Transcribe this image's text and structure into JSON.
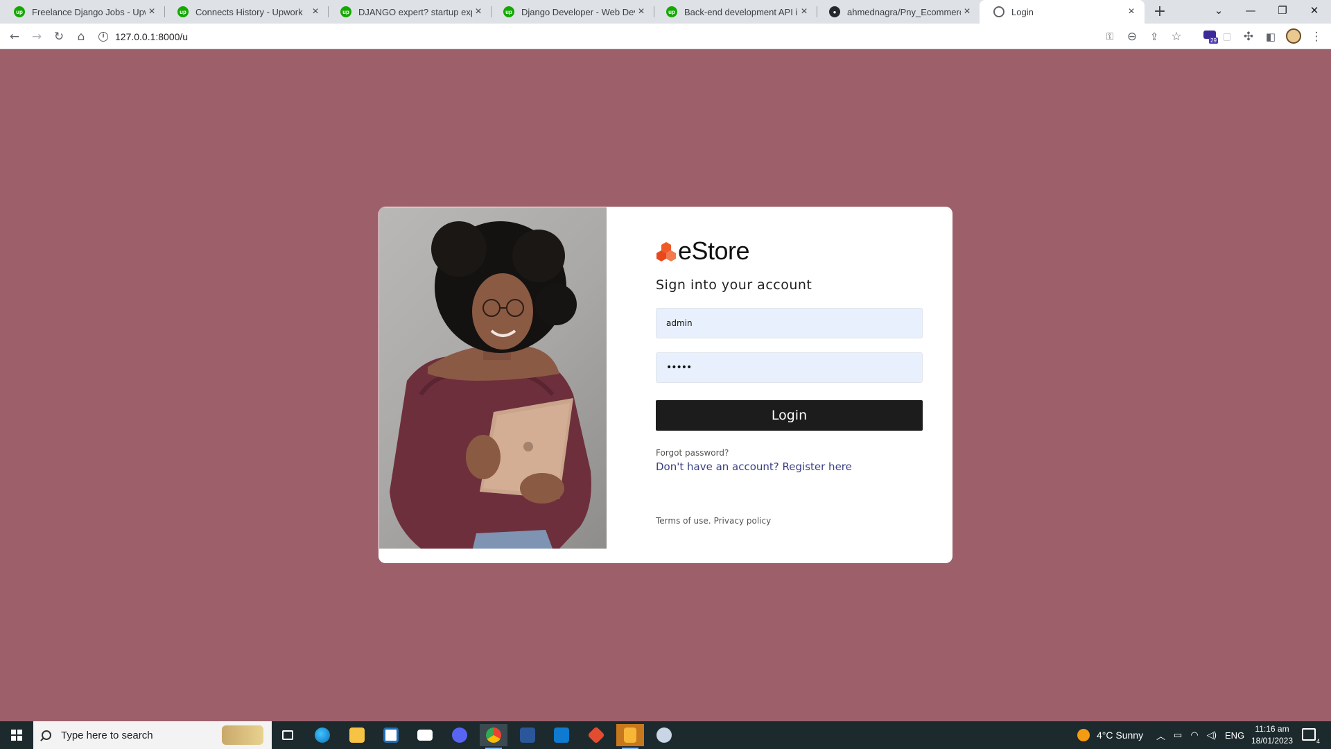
{
  "browser": {
    "tabs": [
      {
        "label": "Freelance Django Jobs - Upwork",
        "icon": "upwork-icon"
      },
      {
        "label": "Connects History - Upwork",
        "icon": "upwork-icon"
      },
      {
        "label": "DJANGO expert? startup experie",
        "icon": "upwork-icon"
      },
      {
        "label": "Django Developer - Web Develo",
        "icon": "upwork-icon"
      },
      {
        "label": "Back-end development API intre",
        "icon": "upwork-icon"
      },
      {
        "label": "ahmednagra/Pny_Ecommerce_S",
        "icon": "github-icon"
      },
      {
        "label": "Login",
        "icon": "globe-icon",
        "active": true
      }
    ],
    "url": "127.0.0.1:8000/u",
    "extension_badge": "29"
  },
  "login": {
    "brand": "eStore",
    "heading": "Sign into your account",
    "username_value": "admin",
    "password_value": "•••••",
    "login_button": "Login",
    "forgot_password": "Forgot password?",
    "register_link": "Don't have an account? Register here",
    "terms": "Terms of use.",
    "privacy": "Privacy policy",
    "accent_color": "#f05a28",
    "background_color": "#9d606b"
  },
  "taskbar": {
    "search_placeholder": "Type here to search",
    "weather": "4°C  Sunny",
    "language": "ENG",
    "time": "11:16 am",
    "date": "18/01/2023",
    "notification_count": "4"
  }
}
